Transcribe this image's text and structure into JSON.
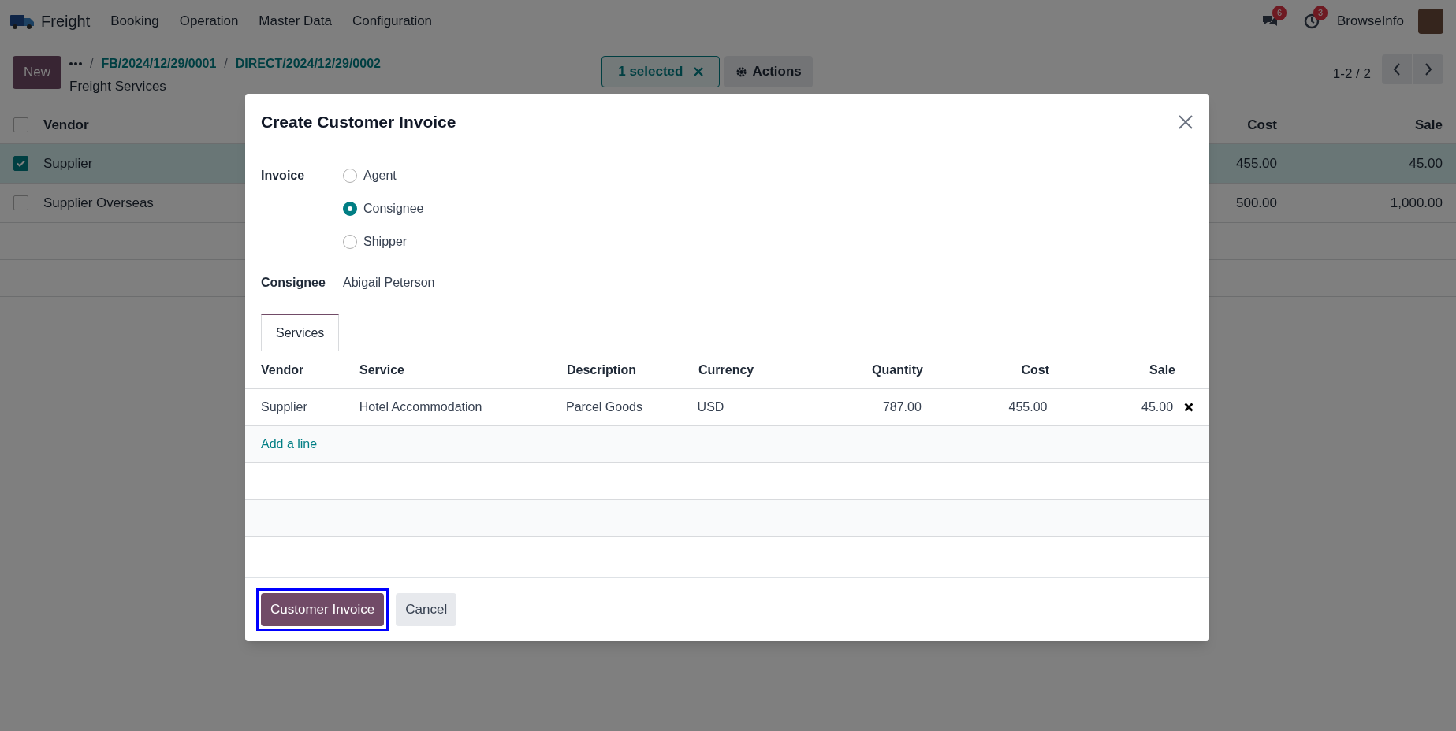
{
  "nav": {
    "app_name": "Freight",
    "menu": [
      "Booking",
      "Operation",
      "Master Data",
      "Configuration"
    ],
    "messages_badge": "6",
    "activities_badge": "3",
    "user": "BrowseInfo"
  },
  "control_panel": {
    "new_button": "New",
    "breadcrumbs": [
      {
        "separator": "/",
        "label": "FB/2024/12/29/0001"
      },
      {
        "separator": "/",
        "label": "DIRECT/2024/12/29/0002"
      }
    ],
    "title": "Freight Services",
    "selection": "1 selected",
    "actions": "Actions",
    "pager": "1-2 / 2"
  },
  "list": {
    "columns": [
      "Vendor",
      "Cost",
      "Sale"
    ],
    "header_checked": false,
    "rows": [
      {
        "vendor": "Supplier",
        "cost": "455.00",
        "sale": "45.00",
        "selected": true
      },
      {
        "vendor": "Supplier Overseas",
        "cost": "500.00",
        "sale": "1,000.00",
        "selected": false
      }
    ]
  },
  "dialog": {
    "title": "Create Customer Invoice",
    "invoice_label": "Invoice",
    "invoice_options": [
      {
        "label": "Agent",
        "selected": false
      },
      {
        "label": "Consignee",
        "selected": true
      },
      {
        "label": "Shipper",
        "selected": false
      }
    ],
    "partner_label": "Consignee",
    "partner_value": "Abigail Peterson",
    "tabs": [
      {
        "label": "Services",
        "selected": true
      }
    ],
    "columns": [
      "Vendor",
      "Service",
      "Description",
      "Currency",
      "Quantity",
      "Cost",
      "Sale"
    ],
    "rows": [
      [
        "Supplier",
        "Hotel Accommodation",
        "Parcel Goods",
        "USD",
        "787.00",
        "455.00",
        "45.00"
      ]
    ],
    "add_line": "Add a line",
    "buttons": [
      {
        "label": "Customer Invoice",
        "kind": "primary",
        "highlighted": true
      },
      {
        "label": "Cancel",
        "kind": "secondary",
        "highlighted": false
      }
    ]
  }
}
